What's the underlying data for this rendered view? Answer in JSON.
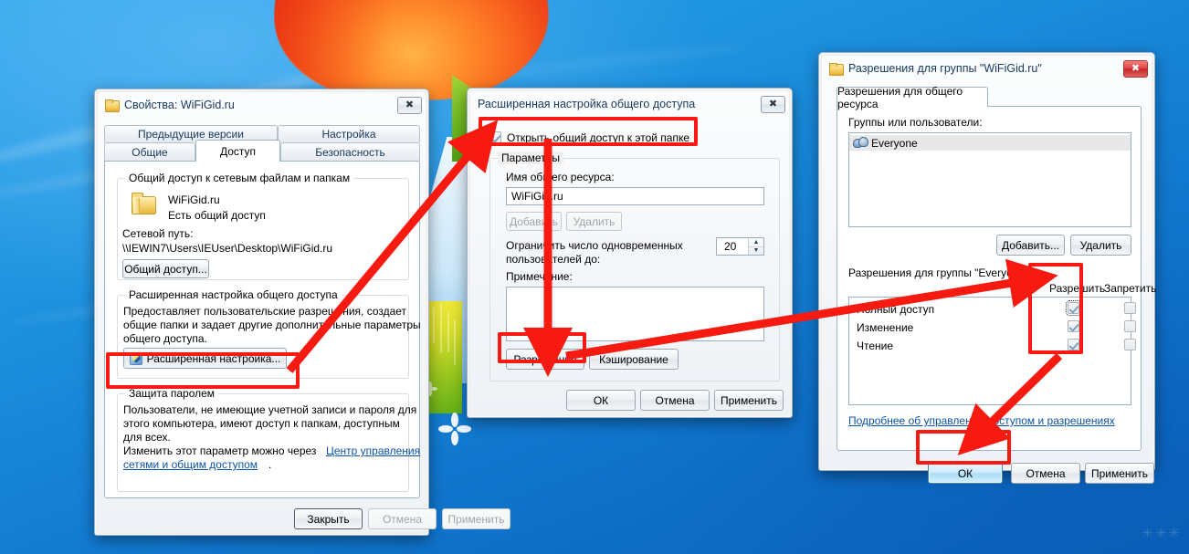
{
  "desktop": {
    "watermark": "✳✳✳"
  },
  "dialog_properties": {
    "title": "Свойства: WiFiGid.ru",
    "icon": "folder-icon",
    "close_label": "✖",
    "tabs_row1": [
      {
        "label": "Предыдущие версии",
        "active": false
      },
      {
        "label": "Настройка",
        "active": false
      }
    ],
    "tabs_row2": [
      {
        "label": "Общие",
        "active": false
      },
      {
        "label": "Доступ",
        "active": true
      },
      {
        "label": "Безопасность",
        "active": false
      }
    ],
    "group_network": {
      "legend": "Общий доступ к сетевым файлам и папкам",
      "folder_name": "WiFiGid.ru",
      "folder_status": "Есть общий доступ",
      "path_label": "Сетевой путь:",
      "path_value": "\\\\IEWIN7\\Users\\IEUser\\Desktop\\WiFiGid.ru",
      "share_button": "Общий доступ..."
    },
    "group_advanced": {
      "legend": "Расширенная настройка общего доступа",
      "description_line1": "Предоставляет пользовательские разрешения, создает",
      "description_line2": "общие папки и задает другие дополнительные параметры",
      "description_line3": "общего доступа.",
      "advanced_button": "Расширенная настройка..."
    },
    "group_password": {
      "legend": "Защита паролем",
      "description_line1": "Пользователи, не имеющие учетной записи и пароля для",
      "description_line2": "этого компьютера, имеют доступ к папкам, доступным",
      "description_line3": "для всех.",
      "description_line4": "Изменить этот параметр можно через",
      "link_part1": "Центр управления",
      "link_part2": "сетями и общим доступом",
      "period": "."
    },
    "footer": {
      "close": "Закрыть",
      "cancel": "Отмена",
      "apply": "Применить"
    }
  },
  "dialog_advanced": {
    "title": "Расширенная настройка общего доступа",
    "close_label": "✖",
    "share_checkbox": {
      "label": "Открыть общий доступ к этой папке",
      "checked": true
    },
    "group_params": {
      "legend": "Параметры",
      "share_name_label": "Имя общего ресурса:",
      "share_name_value": "WiFiGid.ru",
      "add_button": "Добавить",
      "remove_button": "Удалить",
      "limit_label_line1": "Ограничить число одновременных",
      "limit_label_line2": "пользователей до:",
      "limit_value": "20",
      "note_label": "Примечание:",
      "note_value": "",
      "permissions_button": "Разрешения",
      "caching_button": "Кэширование"
    },
    "footer": {
      "ok": "ОК",
      "cancel": "Отмена",
      "apply": "Применить"
    }
  },
  "dialog_permissions": {
    "title": "Разрешения для группы \"WiFiGid.ru\"",
    "close_label": "✖",
    "tab": "Разрешения для общего ресурса",
    "groups_label": "Группы или пользователи:",
    "groups_list": [
      {
        "name": "Everyone",
        "icon": "users-icon",
        "selected": true
      }
    ],
    "add_button": "Добавить...",
    "remove_button": "Удалить",
    "perm_header": "Разрешения для группы \"Everyone\"",
    "col_allow": "Разрешить",
    "col_deny": "Запретить",
    "permissions": [
      {
        "name": "Полный доступ",
        "allow": true,
        "deny": false,
        "focused": true
      },
      {
        "name": "Изменение",
        "allow": true,
        "deny": false,
        "focused": false
      },
      {
        "name": "Чтение",
        "allow": true,
        "deny": false,
        "focused": false
      }
    ],
    "help_link": "Подробнее об управлении доступом и разрешениях",
    "footer": {
      "ok": "ОК",
      "cancel": "Отмена",
      "apply": "Применить"
    }
  },
  "annotations": {
    "accent_color": "#f61a10",
    "boxes": [
      "advanced-settings-button",
      "share-folder-checkbox",
      "permissions-button",
      "allow-column",
      "permissions-ok-button"
    ],
    "arrows": [
      "advanced-button-to-checkbox",
      "checkbox-to-permissions-button",
      "permissions-button-to-allow-column",
      "allow-column-to-ok-button"
    ]
  }
}
